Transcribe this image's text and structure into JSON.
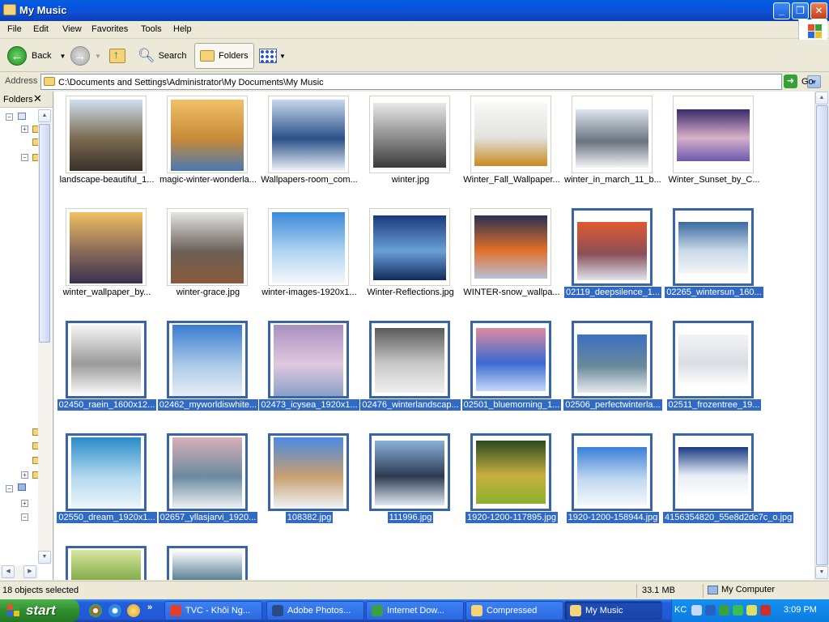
{
  "window": {
    "title": "My Music"
  },
  "menu": [
    "File",
    "Edit",
    "View",
    "Favorites",
    "Tools",
    "Help"
  ],
  "toolbar": {
    "back_label": "Back",
    "search_label": "Search",
    "folders_label": "Folders"
  },
  "address": {
    "label": "Address",
    "path": "C:\\Documents and Settings\\Administrator\\My Documents\\My Music",
    "go_label": "Go"
  },
  "folders_pane": {
    "title": "Folders"
  },
  "items": [
    {
      "name": "landscape-beautiful_1...",
      "selected": false,
      "thumb": [
        "#cfe0f0",
        "#7a6a50",
        "#3a3028"
      ]
    },
    {
      "name": "magic-winter-wonderla...",
      "selected": false,
      "thumb": [
        "#f2c068",
        "#c88a38",
        "#4a78b0"
      ]
    },
    {
      "name": "Wallpapers-room_com...",
      "selected": false,
      "thumb": [
        "#c8d8ec",
        "#2a5088",
        "#eef4fb"
      ]
    },
    {
      "name": "winter.jpg",
      "selected": false,
      "thumb": [
        "#e8e8e8",
        "#8a8a8a",
        "#3a3a3a"
      ]
    },
    {
      "name": "Winter_Fall_Wallpaper...",
      "selected": false,
      "thumb": [
        "#f8f8f6",
        "#e2e2de",
        "#c98a20"
      ]
    },
    {
      "name": "winter_in_march_11_b...",
      "selected": false,
      "thumb": [
        "#dde5ee",
        "#6a7480",
        "#f2f4f6"
      ]
    },
    {
      "name": "Winter_Sunset_by_C...",
      "selected": false,
      "thumb": [
        "#3a2a6a",
        "#d8b0c8",
        "#6a5ab0"
      ]
    },
    {
      "name": "winter_wallpaper_by...",
      "selected": false,
      "thumb": [
        "#f0c060",
        "#8a6a58",
        "#3a3050"
      ]
    },
    {
      "name": "winter-grace.jpg",
      "selected": false,
      "thumb": [
        "#e4e4e2",
        "#6a6058",
        "#8a5a3a"
      ]
    },
    {
      "name": "winter-images-1920x1...",
      "selected": false,
      "thumb": [
        "#3a8ad8",
        "#b0d4f2",
        "#f4f8fb"
      ]
    },
    {
      "name": "Winter-Reflections.jpg",
      "selected": false,
      "thumb": [
        "#1a3a7a",
        "#6aa0d8",
        "#102a5a"
      ]
    },
    {
      "name": "WINTER-snow_wallpa...",
      "selected": false,
      "thumb": [
        "#2a3050",
        "#e0702a",
        "#b8c0d8"
      ]
    },
    {
      "name": "02119_deepsilence_1...",
      "selected": true,
      "thumb": [
        "#e05a30",
        "#8a5058",
        "#dfe4ee"
      ]
    },
    {
      "name": "02265_wintersun_160...",
      "selected": true,
      "thumb": [
        "#3a6aa0",
        "#c8d8e8",
        "#f4f6f8"
      ]
    },
    {
      "name": "02450_raein_1600x12...",
      "selected": true,
      "thumb": [
        "#f6f6f6",
        "#9a9a9a",
        "#ffffff"
      ]
    },
    {
      "name": "02462_myworldiswhite...",
      "selected": true,
      "thumb": [
        "#3a7ad0",
        "#a8c8e8",
        "#e8eef6"
      ]
    },
    {
      "name": "02473_icysea_1920x1...",
      "selected": true,
      "thumb": [
        "#a890c0",
        "#e0c8e0",
        "#8aa0c8"
      ]
    },
    {
      "name": "02476_winterlandscap...",
      "selected": true,
      "thumb": [
        "#5a5a5a",
        "#c8c8c8",
        "#f0f0f0"
      ]
    },
    {
      "name": "02501_bluemorning_1...",
      "selected": true,
      "thumb": [
        "#e08aa0",
        "#3a6ad0",
        "#c8d8f8"
      ]
    },
    {
      "name": "02506_perfectwinterla...",
      "selected": true,
      "thumb": [
        "#3a70c0",
        "#6a8a9a",
        "#e8ecf0"
      ]
    },
    {
      "name": "02511_frozentree_19...",
      "selected": true,
      "thumb": [
        "#f4f4f4",
        "#d8dde4",
        "#ffffff"
      ]
    },
    {
      "name": "02550_dream_1920x1...",
      "selected": true,
      "thumb": [
        "#2a8ac8",
        "#b0d8ee",
        "#eef6fa"
      ]
    },
    {
      "name": "02657_yllasjarvi_1920...",
      "selected": true,
      "thumb": [
        "#d8b0b8",
        "#6a8aa0",
        "#eef2f6"
      ]
    },
    {
      "name": "108382.jpg",
      "selected": true,
      "thumb": [
        "#4a8ae0",
        "#c8a070",
        "#f0f4f8"
      ]
    },
    {
      "name": "111996.jpg",
      "selected": true,
      "thumb": [
        "#8ab0d8",
        "#2a3a50",
        "#dfe8f2"
      ]
    },
    {
      "name": "1920-1200-117895.jpg",
      "selected": true,
      "thumb": [
        "#2a4a20",
        "#c8b040",
        "#8ab030"
      ]
    },
    {
      "name": "1920-1200-158944.jpg",
      "selected": true,
      "thumb": [
        "#3a80d8",
        "#c0d8f0",
        "#f4f8fc"
      ]
    },
    {
      "name": "4156354820_55e8d2dc7c_o.jpg",
      "selected": true,
      "thumb": [
        "#1a3a80",
        "#e8eef6",
        "#ffffff"
      ]
    },
    {
      "name": "",
      "selected": true,
      "thumb": [
        "#d8e8a0",
        "#6a9a30",
        "#f4f8e8"
      ]
    },
    {
      "name": "",
      "selected": true,
      "thumb": [
        "#ffffff",
        "#2a5a78",
        "#6a98b8"
      ]
    }
  ],
  "status": {
    "selection": "18 objects selected",
    "size": "33.1 MB",
    "location": "My Computer"
  },
  "taskbar": {
    "start_label": "start",
    "tasks": [
      {
        "label": "TVC - Khôi Ng...",
        "color": "#e04030",
        "active": false
      },
      {
        "label": "Adobe Photos...",
        "color": "#2a4a8a",
        "active": false
      },
      {
        "label": "Internet Dow...",
        "color": "#3aa040",
        "active": false
      },
      {
        "label": "Compressed",
        "color": "#f5d37a",
        "active": false
      },
      {
        "label": "My Music",
        "color": "#f5d37a",
        "active": true
      }
    ],
    "tray_lang": "KC",
    "clock": "3:09 PM"
  }
}
